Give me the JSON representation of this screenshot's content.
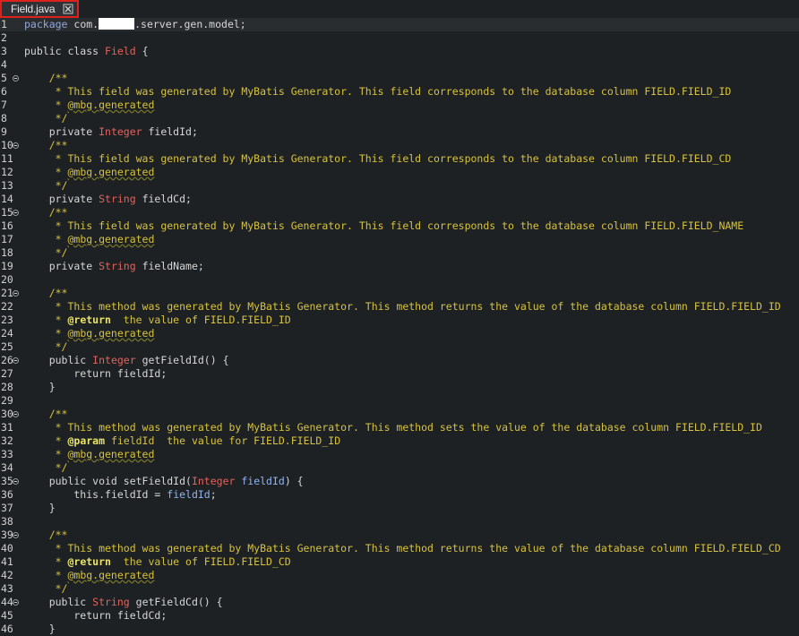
{
  "tab": {
    "title": "Field.java"
  },
  "colors": {
    "tab_highlight": "#e0201b",
    "comment": "#d6c23e",
    "type": "#e2635c",
    "field": "#8fb3f0",
    "keyword": "#d6d6d6"
  },
  "lines": [
    {
      "n": "1",
      "fold": false,
      "segs": [
        [
          "kw-blue",
          "package"
        ],
        [
          "",
          " com."
        ],
        [
          "redact",
          ""
        ],
        [
          "",
          ".server.gen.model;"
        ]
      ]
    },
    {
      "n": "2",
      "fold": false,
      "segs": []
    },
    {
      "n": "3",
      "fold": false,
      "segs": [
        [
          "kw",
          "public class "
        ],
        [
          "type",
          "Field"
        ],
        [
          "",
          " {"
        ]
      ]
    },
    {
      "n": "4",
      "fold": false,
      "segs": []
    },
    {
      "n": "5",
      "fold": true,
      "segs": [
        [
          "cmt",
          "    /**"
        ]
      ]
    },
    {
      "n": "6",
      "fold": false,
      "segs": [
        [
          "cmt",
          "     * This field was generated by MyBatis Generator. This field corresponds to the database column FIELD.FIELD_ID"
        ]
      ]
    },
    {
      "n": "7",
      "fold": false,
      "segs": [
        [
          "cmt",
          "     * "
        ],
        [
          "anno",
          "@mbg.generated"
        ]
      ]
    },
    {
      "n": "8",
      "fold": false,
      "segs": [
        [
          "cmt",
          "     */"
        ]
      ]
    },
    {
      "n": "9",
      "fold": false,
      "segs": [
        [
          "kw",
          "    private "
        ],
        [
          "type",
          "Integer"
        ],
        [
          "",
          " fieldId;"
        ]
      ]
    },
    {
      "n": "10",
      "fold": true,
      "segs": [
        [
          "cmt",
          "    /**"
        ]
      ]
    },
    {
      "n": "11",
      "fold": false,
      "segs": [
        [
          "cmt",
          "     * This field was generated by MyBatis Generator. This field corresponds to the database column FIELD.FIELD_CD"
        ]
      ]
    },
    {
      "n": "12",
      "fold": false,
      "segs": [
        [
          "cmt",
          "     * "
        ],
        [
          "anno",
          "@mbg.generated"
        ]
      ]
    },
    {
      "n": "13",
      "fold": false,
      "segs": [
        [
          "cmt",
          "     */"
        ]
      ]
    },
    {
      "n": "14",
      "fold": false,
      "segs": [
        [
          "kw",
          "    private "
        ],
        [
          "type",
          "String"
        ],
        [
          "",
          " fieldCd;"
        ]
      ]
    },
    {
      "n": "15",
      "fold": true,
      "segs": [
        [
          "cmt",
          "    /**"
        ]
      ]
    },
    {
      "n": "16",
      "fold": false,
      "segs": [
        [
          "cmt",
          "     * This field was generated by MyBatis Generator. This field corresponds to the database column FIELD.FIELD_NAME"
        ]
      ]
    },
    {
      "n": "17",
      "fold": false,
      "segs": [
        [
          "cmt",
          "     * "
        ],
        [
          "anno",
          "@mbg.generated"
        ]
      ]
    },
    {
      "n": "18",
      "fold": false,
      "segs": [
        [
          "cmt",
          "     */"
        ]
      ]
    },
    {
      "n": "19",
      "fold": false,
      "segs": [
        [
          "kw",
          "    private "
        ],
        [
          "type",
          "String"
        ],
        [
          "",
          " fieldName;"
        ]
      ]
    },
    {
      "n": "20",
      "fold": false,
      "segs": []
    },
    {
      "n": "21",
      "fold": true,
      "segs": [
        [
          "cmt",
          "    /**"
        ]
      ]
    },
    {
      "n": "22",
      "fold": false,
      "segs": [
        [
          "cmt",
          "     * This method was generated by MyBatis Generator. This method returns the value of the database column FIELD.FIELD_ID"
        ]
      ]
    },
    {
      "n": "23",
      "fold": false,
      "segs": [
        [
          "cmt",
          "     * "
        ],
        [
          "tag",
          "@return"
        ],
        [
          "cmt",
          "  the value of FIELD.FIELD_ID"
        ]
      ]
    },
    {
      "n": "24",
      "fold": false,
      "segs": [
        [
          "cmt",
          "     * "
        ],
        [
          "anno",
          "@mbg.generated"
        ]
      ]
    },
    {
      "n": "25",
      "fold": false,
      "segs": [
        [
          "cmt",
          "     */"
        ]
      ]
    },
    {
      "n": "26",
      "fold": true,
      "segs": [
        [
          "kw",
          "    public "
        ],
        [
          "type",
          "Integer"
        ],
        [
          "",
          " getFieldId() {"
        ]
      ]
    },
    {
      "n": "27",
      "fold": false,
      "segs": [
        [
          "kw",
          "        return "
        ],
        [
          "",
          "fieldId;"
        ]
      ]
    },
    {
      "n": "28",
      "fold": false,
      "segs": [
        [
          "",
          "    }"
        ]
      ]
    },
    {
      "n": "29",
      "fold": false,
      "segs": []
    },
    {
      "n": "30",
      "fold": true,
      "segs": [
        [
          "cmt",
          "    /**"
        ]
      ]
    },
    {
      "n": "31",
      "fold": false,
      "segs": [
        [
          "cmt",
          "     * This method was generated by MyBatis Generator. This method sets the value of the database column FIELD.FIELD_ID"
        ]
      ]
    },
    {
      "n": "32",
      "fold": false,
      "segs": [
        [
          "cmt",
          "     * "
        ],
        [
          "tag",
          "@param"
        ],
        [
          "cmt",
          " fieldId  the value for FIELD.FIELD_ID"
        ]
      ]
    },
    {
      "n": "33",
      "fold": false,
      "segs": [
        [
          "cmt",
          "     * "
        ],
        [
          "anno",
          "@mbg.generated"
        ]
      ]
    },
    {
      "n": "34",
      "fold": false,
      "segs": [
        [
          "cmt",
          "     */"
        ]
      ]
    },
    {
      "n": "35",
      "fold": true,
      "segs": [
        [
          "kw",
          "    public void "
        ],
        [
          "",
          "setFieldId("
        ],
        [
          "type",
          "Integer"
        ],
        [
          "",
          " "
        ],
        [
          "field",
          "fieldId"
        ],
        [
          "",
          ") {"
        ]
      ]
    },
    {
      "n": "36",
      "fold": false,
      "segs": [
        [
          "kw",
          "        this."
        ],
        [
          "",
          "fieldId = "
        ],
        [
          "field",
          "fieldId"
        ],
        [
          "",
          ";"
        ]
      ]
    },
    {
      "n": "37",
      "fold": false,
      "segs": [
        [
          "",
          "    }"
        ]
      ]
    },
    {
      "n": "38",
      "fold": false,
      "segs": []
    },
    {
      "n": "39",
      "fold": true,
      "segs": [
        [
          "cmt",
          "    /**"
        ]
      ]
    },
    {
      "n": "40",
      "fold": false,
      "segs": [
        [
          "cmt",
          "     * This method was generated by MyBatis Generator. This method returns the value of the database column FIELD.FIELD_CD"
        ]
      ]
    },
    {
      "n": "41",
      "fold": false,
      "segs": [
        [
          "cmt",
          "     * "
        ],
        [
          "tag",
          "@return"
        ],
        [
          "cmt",
          "  the value of FIELD.FIELD_CD"
        ]
      ]
    },
    {
      "n": "42",
      "fold": false,
      "segs": [
        [
          "cmt",
          "     * "
        ],
        [
          "anno",
          "@mbg.generated"
        ]
      ]
    },
    {
      "n": "43",
      "fold": false,
      "segs": [
        [
          "cmt",
          "     */"
        ]
      ]
    },
    {
      "n": "44",
      "fold": true,
      "segs": [
        [
          "kw",
          "    public "
        ],
        [
          "type",
          "String"
        ],
        [
          "",
          " getFieldCd() {"
        ]
      ]
    },
    {
      "n": "45",
      "fold": false,
      "segs": [
        [
          "kw",
          "        return "
        ],
        [
          "",
          "fieldCd;"
        ]
      ]
    },
    {
      "n": "46",
      "fold": false,
      "segs": [
        [
          "",
          "    }"
        ]
      ]
    }
  ]
}
